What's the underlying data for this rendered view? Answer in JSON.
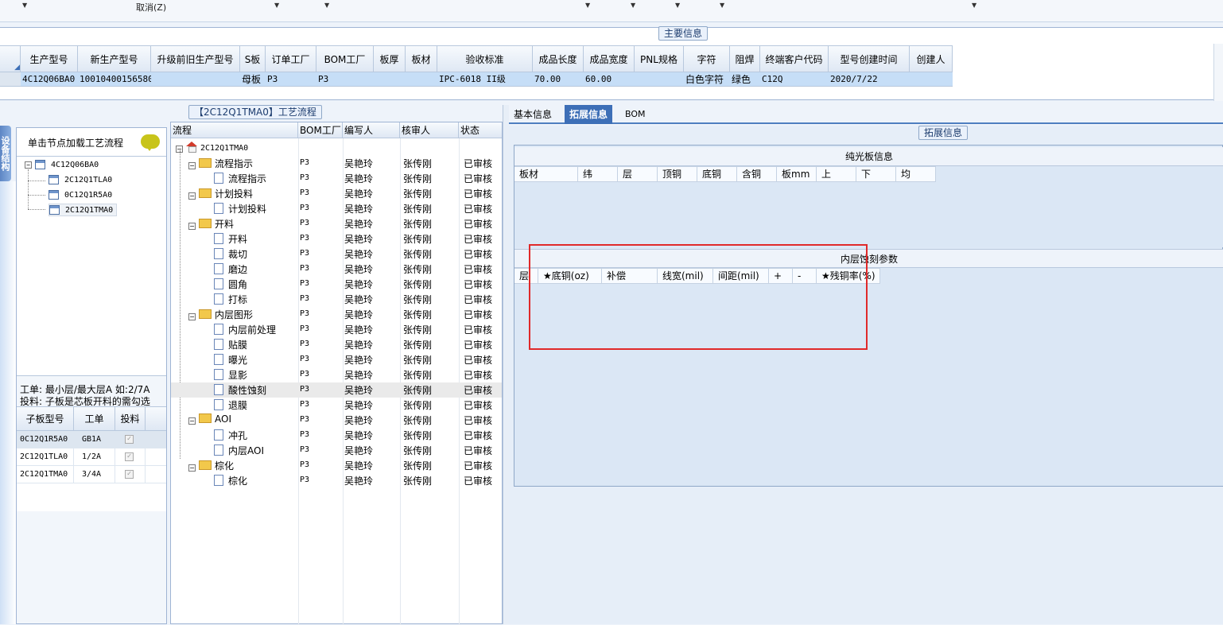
{
  "toolbar": {
    "cancel_label": "取消(Z)"
  },
  "main_info": {
    "group_title": "主要信息",
    "columns": [
      "生产型号",
      "新生产型号",
      "升级前旧生产型号",
      "S板",
      "订单工厂",
      "BOM工厂",
      "板厚",
      "板材",
      "验收标准",
      "成品长度",
      "成品宽度",
      "PNL规格",
      "字符",
      "阻焊",
      "终端客户代码",
      "型号创建时间",
      "创建人"
    ],
    "row": [
      "4C12Q06BA0",
      "10010400156580",
      "",
      "母板",
      "P3",
      "P3",
      "",
      "",
      "IPC-6018 II级",
      "70.00",
      "60.00",
      "",
      "白色字符",
      "绿色",
      "C12Q",
      "2020/7/22",
      ""
    ]
  },
  "left_tab": {
    "label": "设备结构"
  },
  "node_panel": {
    "hint": "单击节点加载工艺流程",
    "tree": {
      "root": "4C12Q06BA0",
      "children": [
        "2C12Q1TLA0",
        "0C12Q1R5A0",
        "2C12Q1TMA0"
      ]
    },
    "note_line1": "工单: 最小层/最大层A 如:2/7A",
    "note_line2": "投料: 子板是芯板开料的需勾选",
    "sub_columns": [
      "子板型号",
      "工单",
      "投料"
    ],
    "sub_rows": [
      {
        "model": "0C12Q1R5A0",
        "order": "GB1A",
        "feed": "✓"
      },
      {
        "model": "2C12Q1TLA0",
        "order": "1/2A",
        "feed": "✓"
      },
      {
        "model": "2C12Q1TMA0",
        "order": "3/4A",
        "feed": "✓"
      }
    ]
  },
  "flow": {
    "title": "【2C12Q1TMA0】工艺流程",
    "columns": [
      "流程",
      "BOM工厂",
      "编写人",
      "核审人",
      "状态"
    ],
    "root": "2C12Q1TMA0",
    "rows": [
      {
        "name": "流程指示",
        "factory": "P3",
        "writer": "吴艳玲",
        "reviewer": "张传刚",
        "status": "已审核"
      },
      {
        "name": "流程指示",
        "factory": "P3",
        "writer": "吴艳玲",
        "reviewer": "张传刚",
        "status": "已审核"
      },
      {
        "name": "计划投料",
        "factory": "P3",
        "writer": "吴艳玲",
        "reviewer": "张传刚",
        "status": "已审核"
      },
      {
        "name": "计划投料",
        "factory": "P3",
        "writer": "吴艳玲",
        "reviewer": "张传刚",
        "status": "已审核"
      },
      {
        "name": "开料",
        "factory": "P3",
        "writer": "吴艳玲",
        "reviewer": "张传刚",
        "status": "已审核"
      },
      {
        "name": "开料",
        "factory": "P3",
        "writer": "吴艳玲",
        "reviewer": "张传刚",
        "status": "已审核"
      },
      {
        "name": "裁切",
        "factory": "P3",
        "writer": "吴艳玲",
        "reviewer": "张传刚",
        "status": "已审核"
      },
      {
        "name": "磨边",
        "factory": "P3",
        "writer": "吴艳玲",
        "reviewer": "张传刚",
        "status": "已审核"
      },
      {
        "name": "圆角",
        "factory": "P3",
        "writer": "吴艳玲",
        "reviewer": "张传刚",
        "status": "已审核"
      },
      {
        "name": "打标",
        "factory": "P3",
        "writer": "吴艳玲",
        "reviewer": "张传刚",
        "status": "已审核"
      },
      {
        "name": "内层图形",
        "factory": "P3",
        "writer": "吴艳玲",
        "reviewer": "张传刚",
        "status": "已审核"
      },
      {
        "name": "内层前处理",
        "factory": "P3",
        "writer": "吴艳玲",
        "reviewer": "张传刚",
        "status": "已审核"
      },
      {
        "name": "贴膜",
        "factory": "P3",
        "writer": "吴艳玲",
        "reviewer": "张传刚",
        "status": "已审核"
      },
      {
        "name": "曝光",
        "factory": "P3",
        "writer": "吴艳玲",
        "reviewer": "张传刚",
        "status": "已审核"
      },
      {
        "name": "显影",
        "factory": "P3",
        "writer": "吴艳玲",
        "reviewer": "张传刚",
        "status": "已审核"
      },
      {
        "name": "酸性蚀刻",
        "factory": "P3",
        "writer": "吴艳玲",
        "reviewer": "张传刚",
        "status": "已审核"
      },
      {
        "name": "退膜",
        "factory": "P3",
        "writer": "吴艳玲",
        "reviewer": "张传刚",
        "status": "已审核"
      },
      {
        "name": "AOI",
        "factory": "P3",
        "writer": "吴艳玲",
        "reviewer": "张传刚",
        "status": "已审核"
      },
      {
        "name": "冲孔",
        "factory": "P3",
        "writer": "吴艳玲",
        "reviewer": "张传刚",
        "status": "已审核"
      },
      {
        "name": "内层AOI",
        "factory": "P3",
        "writer": "吴艳玲",
        "reviewer": "张传刚",
        "status": "已审核"
      },
      {
        "name": "棕化",
        "factory": "P3",
        "writer": "吴艳玲",
        "reviewer": "张传刚",
        "status": "已审核"
      },
      {
        "name": "棕化",
        "factory": "P3",
        "writer": "吴艳玲",
        "reviewer": "张传刚",
        "status": "已审核"
      }
    ]
  },
  "right": {
    "tabs": [
      "基本信息",
      "拓展信息",
      "BOM"
    ],
    "group_title": "拓展信息",
    "section1": {
      "title": "纯光板信息",
      "columns": [
        "板材",
        "纬",
        "层",
        "顶铜",
        "底铜",
        "含铜",
        "板mm",
        "上",
        "下",
        "均"
      ]
    },
    "section2": {
      "title": "内层蚀刻参数",
      "columns": [
        "层",
        "★底铜(oz)",
        "补偿",
        "线宽(mil)",
        "间距(mil)",
        "+",
        "-",
        "★残铜率(%)"
      ]
    }
  }
}
